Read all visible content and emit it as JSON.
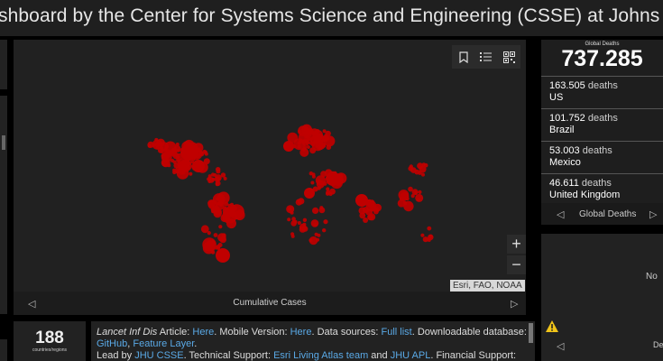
{
  "header": {
    "title": "shboard by the Center for Systems Science and Engineering (CSSE) at Johns Hopkins"
  },
  "map": {
    "footer_label": "Cumulative Cases",
    "attribution": "Esri, FAO, NOAA",
    "zoom_in": "+",
    "zoom_out": "−",
    "prev": "◁",
    "next": "▷",
    "marker_color": "#c00000",
    "tools": [
      "bookmark-icon",
      "list-icon",
      "qr-grid-icon"
    ]
  },
  "deaths": {
    "heading": "Global Deaths",
    "total": "737.285",
    "unit": "deaths",
    "rows": [
      {
        "value": "163.505",
        "country": "US"
      },
      {
        "value": "101.752",
        "country": "Brazil"
      },
      {
        "value": "53.003",
        "country": "Mexico"
      },
      {
        "value": "46.611",
        "country": "United Kingdom"
      }
    ],
    "footer_label": "Global Deaths",
    "prev": "◁",
    "next": "▷"
  },
  "right_bottom": {
    "text": "No",
    "text2": "De",
    "prev": "◁"
  },
  "countries": {
    "count": "188",
    "label": "countries/regions"
  },
  "info": {
    "article_label": "Lancet Inf Dis",
    "t1": " Article: ",
    "here1": "Here",
    "t2": ". Mobile Version: ",
    "here2": "Here",
    "t3": ". Data sources: ",
    "full_list": "Full list",
    "t4": ". Downloadable database: ",
    "github": "GitHub",
    "t5": ", ",
    "feature_layer": "Feature Layer",
    "t6": ".",
    "t7": "Lead by ",
    "jhu_csse": "JHU CSSE",
    "t8": ". Technical Support: ",
    "esri_team": "Esri Living Atlas team",
    "t9": " and ",
    "jhu_apl": "JHU APL",
    "t10": ". Financial Support:"
  },
  "warning": {
    "icon": "warning-icon",
    "color": "#f0c419"
  }
}
